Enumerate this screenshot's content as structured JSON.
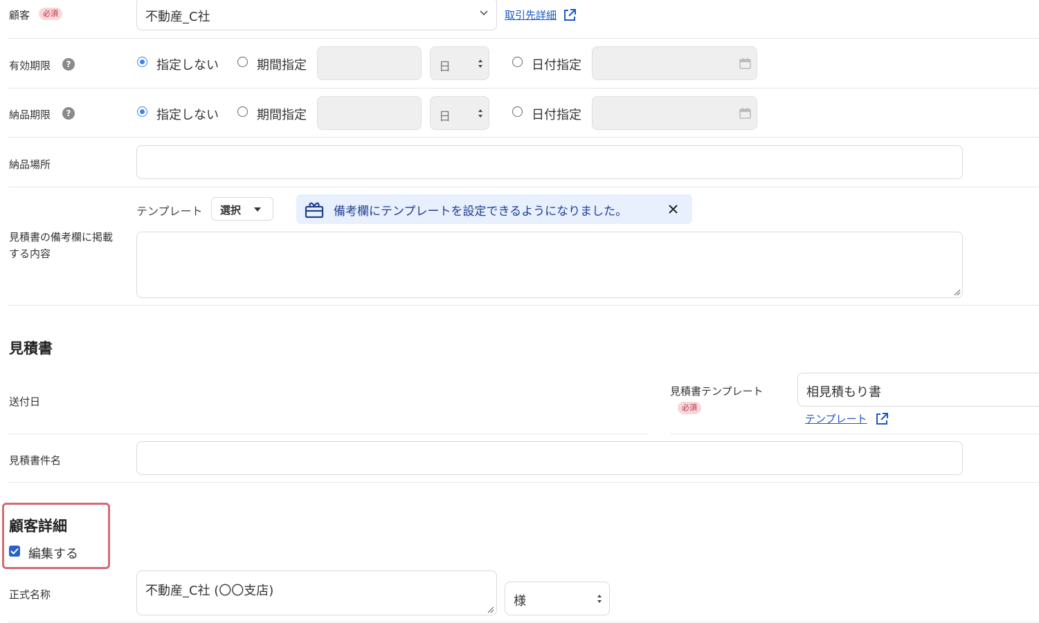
{
  "customer": {
    "label": "顧客",
    "required_badge": "必須",
    "select_value": "不動産_C社",
    "detail_link": "取引先詳細"
  },
  "validity": {
    "label": "有効期限",
    "opt_none": "指定しない",
    "opt_period": "期間指定",
    "unit_value": "日",
    "opt_date": "日付指定"
  },
  "delivery_deadline": {
    "label": "納品期限",
    "opt_none": "指定しない",
    "opt_period": "期間指定",
    "unit_value": "日",
    "opt_date": "日付指定"
  },
  "delivery_place": {
    "label": "納品場所"
  },
  "remarks": {
    "template_label": "テンプレート",
    "template_select": "選択",
    "notice": "備考欄にテンプレートを設定できるようになりました。",
    "label_line1": "見積書の備考欄に掲載",
    "label_line2": "する内容"
  },
  "estimate_section": {
    "title": "見積書",
    "send_date_label": "送付日",
    "template_label": "見積書テンプレート",
    "required_badge": "必須",
    "template_value": "相見積もり書",
    "template_link": "テンプレート",
    "name_label": "見積書件名"
  },
  "customer_detail": {
    "title": "顧客詳細",
    "edit_checkbox_label": "編集する",
    "official_name_label": "正式名称",
    "official_name_value": "不動産_C社 (〇〇支店)",
    "honorific_value": "様"
  },
  "colors": {
    "accent": "#3b82f6",
    "link": "#1a56c9",
    "notice_bg": "#e8f0fe",
    "notice_text": "#1f3f8f",
    "highlight_border": "#d46a72"
  }
}
